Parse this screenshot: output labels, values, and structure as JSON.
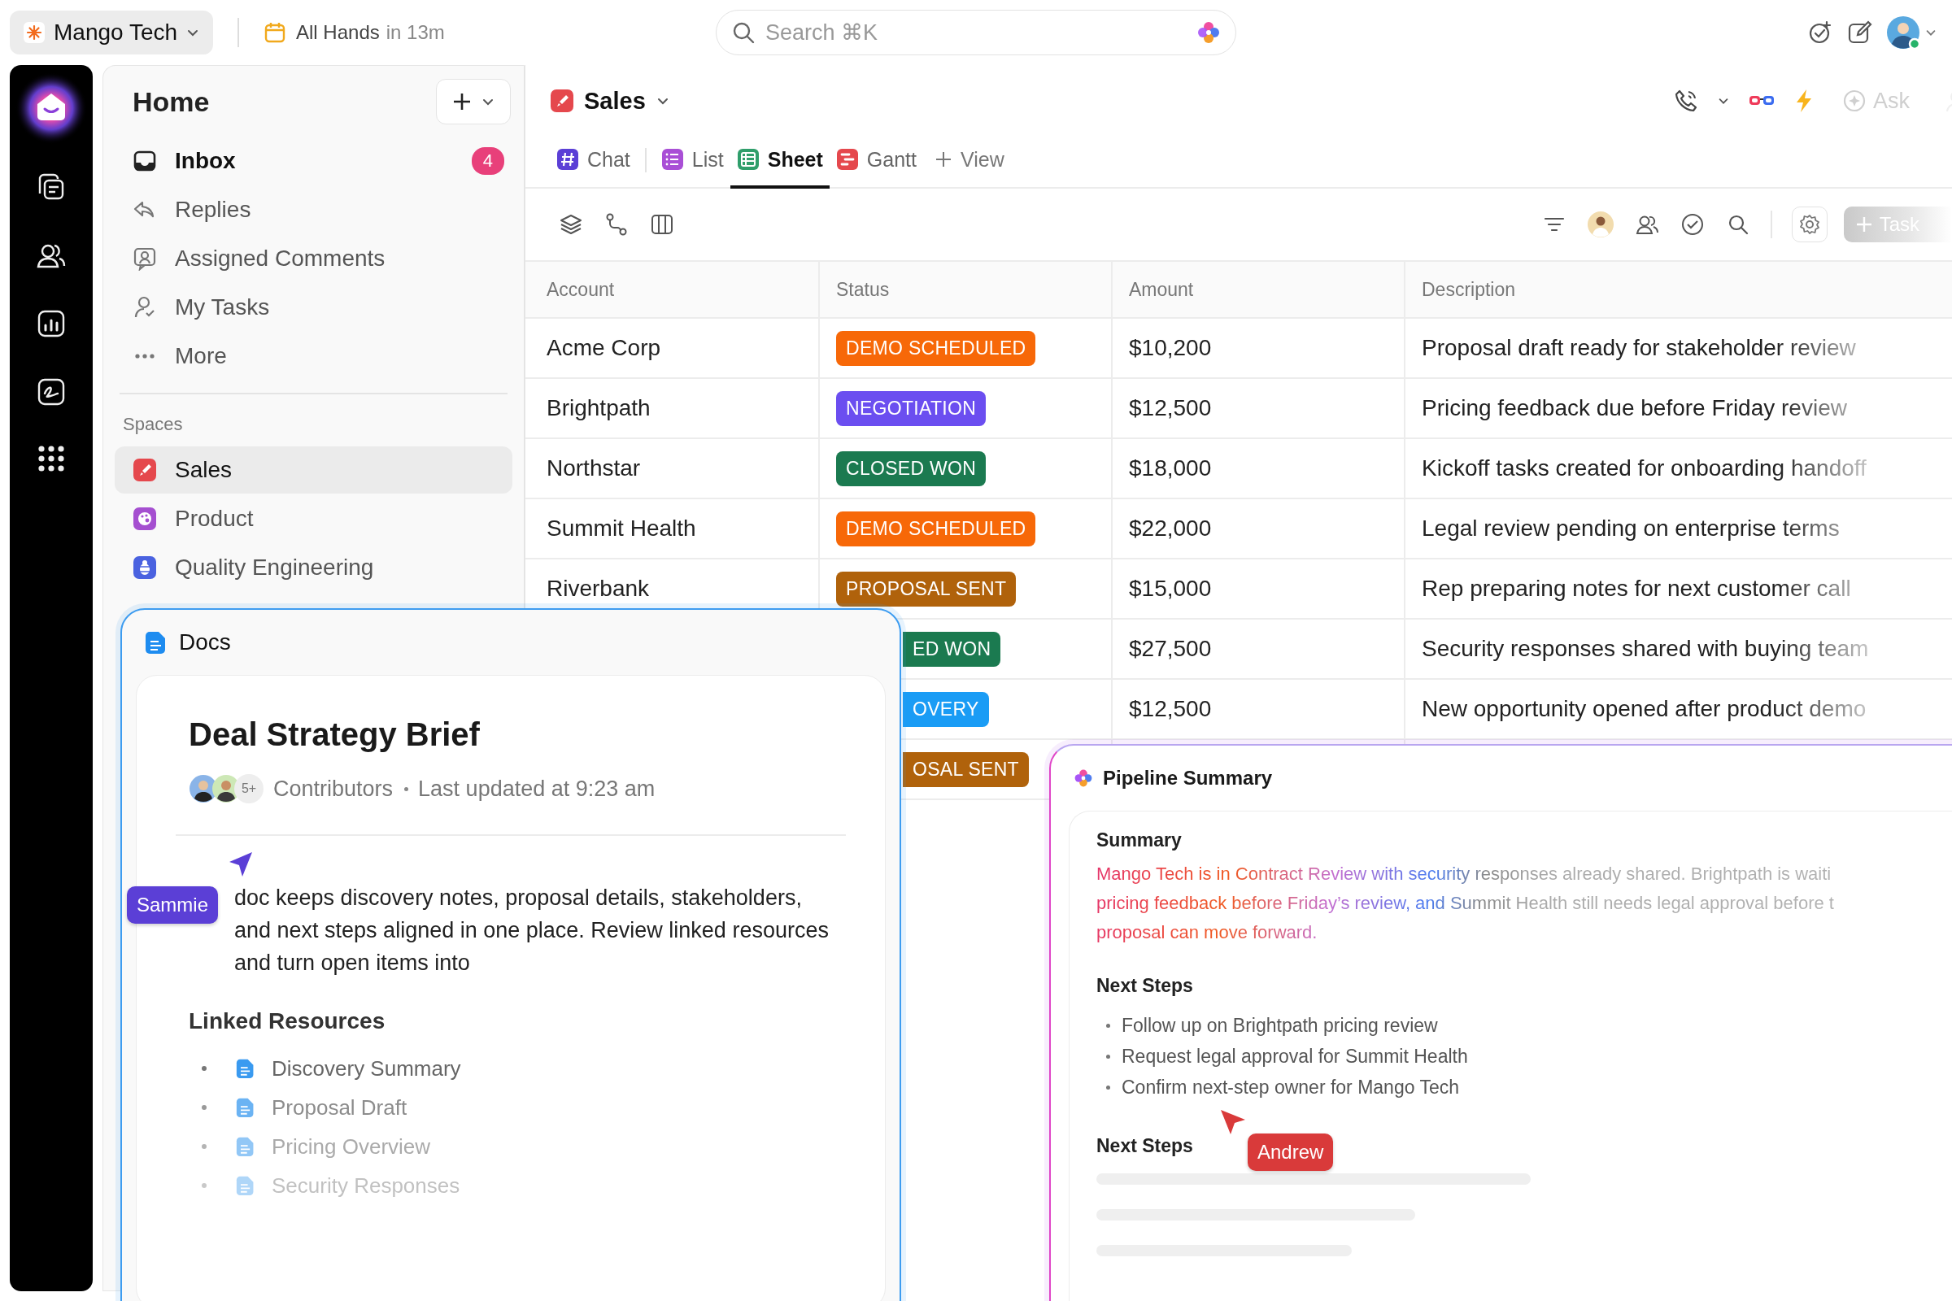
{
  "workspace": {
    "name": "Mango Tech"
  },
  "meeting": {
    "title": "All Hands",
    "time": "in 13m"
  },
  "search": {
    "placeholder": "Search ⌘K"
  },
  "home": {
    "title": "Home",
    "items": [
      {
        "label": "Inbox",
        "unread": true,
        "badge": "4"
      },
      {
        "label": "Replies",
        "unread": false
      },
      {
        "label": "Assigned Comments",
        "unread": false
      },
      {
        "label": "My Tasks",
        "unread": false
      },
      {
        "label": "More",
        "unread": false
      }
    ]
  },
  "spaces": {
    "title": "Spaces",
    "items": [
      {
        "label": "Sales",
        "selected": true,
        "color": "#e5484d"
      },
      {
        "label": "Product",
        "selected": false,
        "color": "#a54fd0"
      },
      {
        "label": "Quality Engineering",
        "selected": false,
        "color": "#4a62e0"
      }
    ]
  },
  "space": {
    "title": "Sales",
    "ask": "Ask",
    "add_task": "Task",
    "add_view": "View"
  },
  "tabs": [
    {
      "label": "Chat",
      "selected": false,
      "color": "#5b3fd6"
    },
    {
      "label": "List",
      "selected": false,
      "color": "#a94fd6"
    },
    {
      "label": "Sheet",
      "selected": true,
      "color": "#2f9e6b"
    },
    {
      "label": "Gantt",
      "selected": false,
      "color": "#e5484d"
    }
  ],
  "table": {
    "columns": [
      "Account",
      "Status",
      "Amount",
      "Description"
    ],
    "rows": [
      {
        "account": "Acme Corp",
        "status": "DEMO SCHEDULED",
        "color": "#f76808",
        "amount": "$10,200",
        "description": "Proposal draft ready for stakeholder review"
      },
      {
        "account": "Brightpath",
        "status": "NEGOTIATION",
        "color": "#6b4ef0",
        "amount": "$12,500",
        "description": "Pricing feedback due before Friday review"
      },
      {
        "account": "Northstar",
        "status": "CLOSED WON",
        "color": "#1b7a50",
        "amount": "$18,000",
        "description": "Kickoff tasks created for onboarding handoff"
      },
      {
        "account": "Summit Health",
        "status": "DEMO SCHEDULED",
        "color": "#f76808",
        "amount": "$22,000",
        "description": "Legal review pending on enterprise terms"
      },
      {
        "account": "Riverbank",
        "status": "PROPOSAL SENT",
        "color": "#b0620b",
        "amount": "$15,000",
        "description": "Rep preparing notes for next customer call"
      },
      {
        "status": "ED WON",
        "color": "#1b7a50",
        "amount": "$27,500",
        "description": "Security responses shared with buying team"
      },
      {
        "status": "OVERY",
        "color": "#1a9cf5",
        "amount": "$12,500",
        "description": "New opportunity opened after product demo"
      },
      {
        "status": "OSAL SENT",
        "color": "#b0620b"
      }
    ]
  },
  "docs": {
    "title": "Docs",
    "doc_title": "Deal Strategy Brief",
    "contributors_more": "5+",
    "contributors_label": "Contributors",
    "updated": "Last updated at 9:23 am",
    "body": "doc keeps discovery notes, proposal details, stakeholders, and next steps aligned in one place. Review linked resources and turn open items into",
    "section": "Linked Resources",
    "resources": [
      "Discovery Summary",
      "Proposal Draft",
      "Pricing Overview",
      "Security Responses"
    ],
    "cursor": {
      "name": "Sammie",
      "color": "#5b3fd6"
    }
  },
  "pipeline": {
    "title": "Pipeline Summary",
    "summary_heading": "Summary",
    "summary_lines": [
      "Mango Tech is in Contract Review with security responses already shared. Brightpath is waiti",
      "pricing feedback before Friday’s review, and Summit Health still needs legal approval before t",
      "proposal can move forward."
    ],
    "steps_heading": "Next Steps",
    "steps": [
      "Follow up on Brightpath pricing review",
      "Request legal approval for Summit Health",
      "Confirm next-step owner for Mango Tech"
    ],
    "second_heading": "Next Steps",
    "cursor": {
      "name": "Andrew",
      "color": "#d93a3a"
    }
  }
}
